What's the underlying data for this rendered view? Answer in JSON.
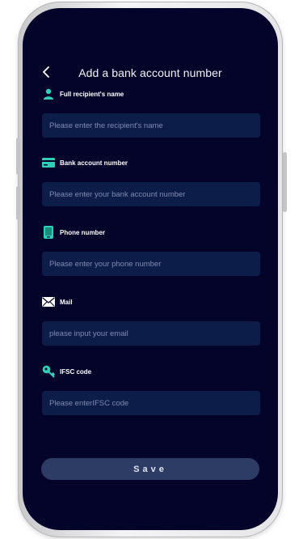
{
  "header": {
    "title": "Add a bank account number"
  },
  "fields": [
    {
      "icon": "person-icon",
      "label": "Full recipient's name",
      "placeholder": "Please enter the recipient's name"
    },
    {
      "icon": "card-icon",
      "label": "Bank account number",
      "placeholder": "Please enter your bank account number"
    },
    {
      "icon": "phone-icon",
      "label": "Phone number",
      "placeholder": "Please enter your phone number"
    },
    {
      "icon": "mail-icon",
      "label": "Mail",
      "placeholder": "please input your email"
    },
    {
      "icon": "key-icon",
      "label": "IFSC code",
      "placeholder": "Please enterIFSC code"
    }
  ],
  "save_label": "Save",
  "colors": {
    "accent": "#2fd0b8",
    "background": "#04042b",
    "input_bg": "#0d1d4a",
    "button_bg": "#2c3c64"
  }
}
